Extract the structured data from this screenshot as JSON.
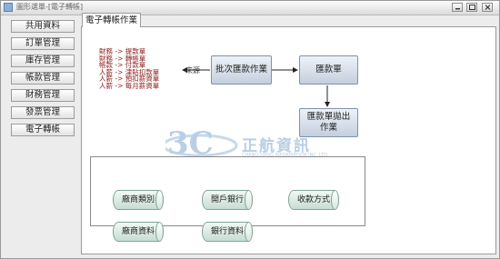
{
  "window": {
    "title": "圖形選單-[電子轉帳]"
  },
  "sidebar": {
    "items": [
      {
        "label": "共用資料"
      },
      {
        "label": "訂單管理"
      },
      {
        "label": "庫存管理"
      },
      {
        "label": "帳款管理"
      },
      {
        "label": "財務管理"
      },
      {
        "label": "發票管理"
      },
      {
        "label": "電子轉帳"
      }
    ]
  },
  "tabs": [
    {
      "label": "電子轉帳作業"
    }
  ],
  "diagram": {
    "legend": [
      "財務 -> 提款單",
      "財務 -> 轉帳單",
      "帳款 -> 付款單",
      "人薪 -> 津貼扣款單",
      "人薪 -> 預扣薪資單",
      "人薪 -> 每月薪資單"
    ],
    "source_label": "來源",
    "batch_node": "批次匯款作業",
    "remit_node": "匯款單",
    "export_node_line1": "匯款單拋出",
    "export_node_line2": "作業",
    "master_files": {
      "vendor_category": "廠商類別",
      "bank_account": "開戶銀行",
      "payment_method": "收款方式",
      "vendor_data": "廠商資料",
      "bank_data": "銀行資料"
    }
  },
  "watermark": {
    "logo_text": "3C",
    "company_name": "正航資訊",
    "company_en": "CHANG-HANG INFORMATION INC. LTD."
  },
  "colors": {
    "legend_text": "#8a1c1c",
    "process_node": "#c4cfdd",
    "master_file": "#c6ddd3"
  }
}
